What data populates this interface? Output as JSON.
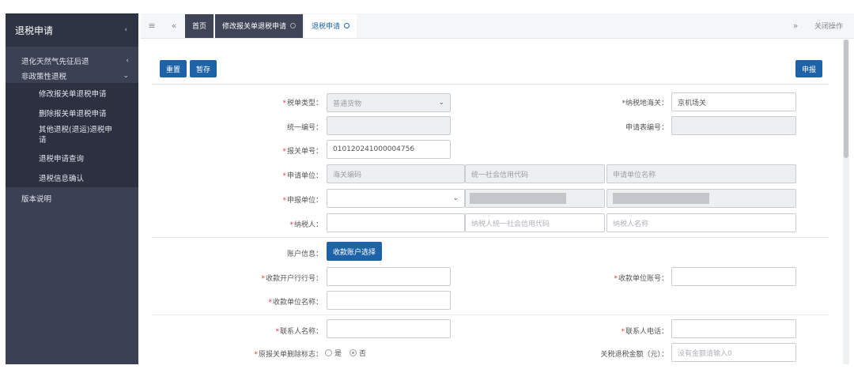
{
  "sidebar": {
    "title": "退税申请",
    "items": [
      {
        "label": "退化天然气先征后退"
      },
      {
        "label": "非政策性退税"
      }
    ],
    "sub_items": [
      {
        "label": "修改报关单退税申请"
      },
      {
        "label": "删除报关单退税申请"
      },
      {
        "label": "其他退税(退运)退税申请"
      },
      {
        "label": "退税申请查询"
      },
      {
        "label": "退税信息确认"
      }
    ],
    "bottom_item": "版本说明"
  },
  "tabs": {
    "home": "首页",
    "tab1": "修改报关单退税申请",
    "tab2": "退税申请",
    "close_ops": "关闭操作"
  },
  "toolbar": {
    "reset": "重置",
    "save": "暂存",
    "submit": "申报"
  },
  "form": {
    "doc_type_label": "税单类型：",
    "doc_type_value": "普通货物",
    "customs_label": "*纳税地海关：",
    "customs_value": "京机场关",
    "uniform_no_label": "统一编号：",
    "apply_no_label": "申请表编号：",
    "declaration_no_label": "报关单号：",
    "declaration_no_value": "010120241000004756",
    "applicant_label": "申请单位：",
    "applicant_ph1": "海关编码",
    "applicant_ph2": "统一社会信用代码",
    "applicant_ph3": "申请单位名称",
    "declarer_label": "申报单位：",
    "taxpayer_label": "纳税人：",
    "taxpayer_ph1": "纳税人统一社会信用代码",
    "taxpayer_ph2": "纳税人名称",
    "account_info_label": "账户信息：",
    "account_select_btn": "收款账户选择",
    "bank_label": "收款开户行行号：",
    "account_no_label": "收款单位账号：",
    "payee_name_label": "收款单位名称：",
    "contact_name_label": "联系人名称：",
    "contact_phone_label": "联系人电话：",
    "delete_flag_label": "原报关单删除标志：",
    "yes": "是",
    "no": "否",
    "amount_label": "关税退税金额（元）：",
    "amount_ph": "没有金额请输入0"
  }
}
